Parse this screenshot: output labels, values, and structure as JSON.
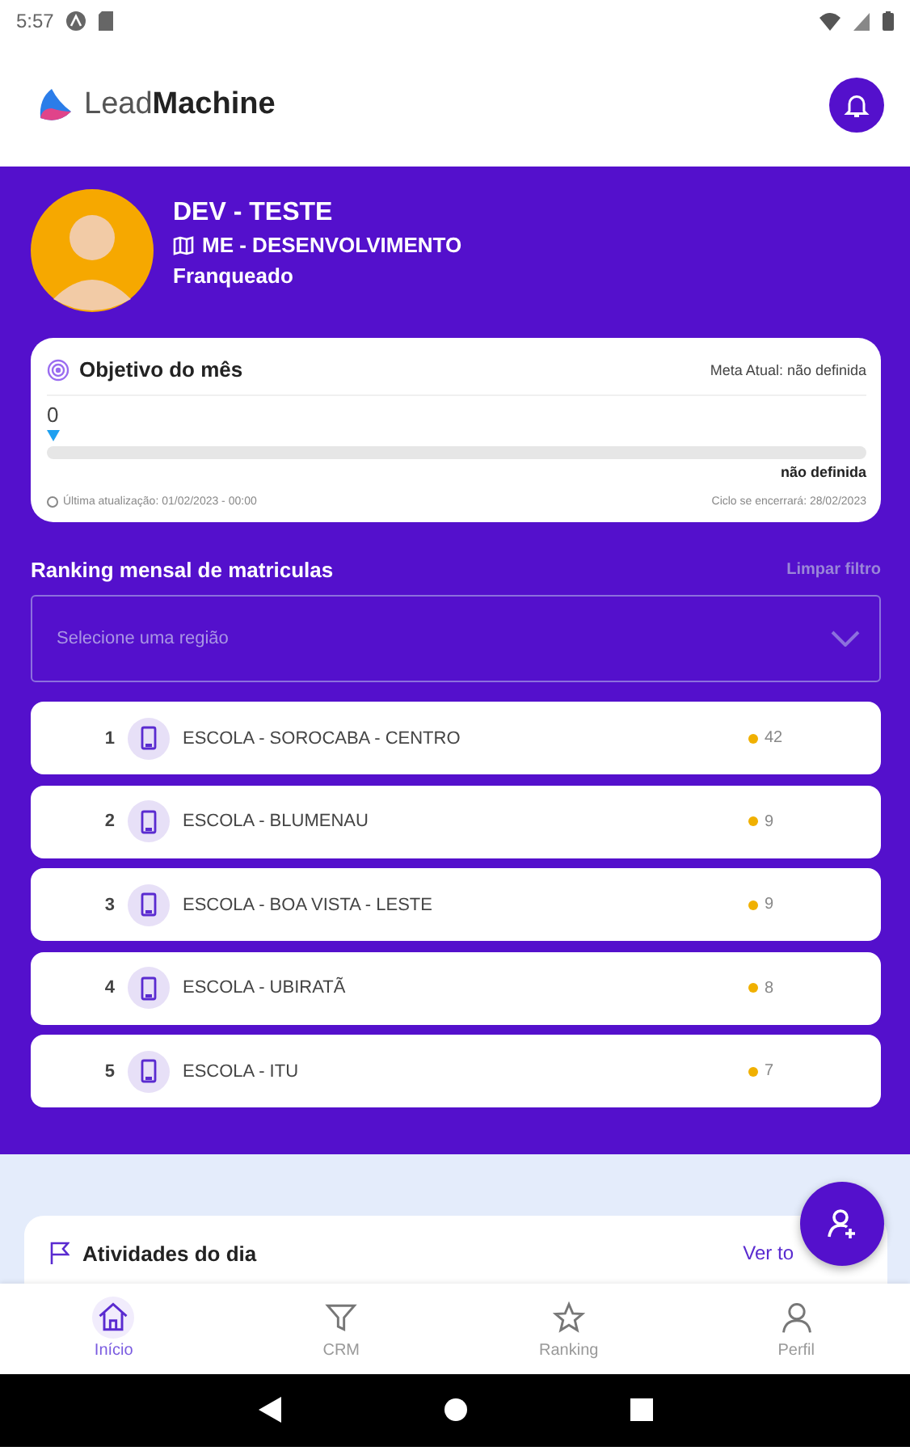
{
  "status_bar": {
    "time": "5:57"
  },
  "header": {
    "brand_light": "Lead",
    "brand_bold": "Machine"
  },
  "profile": {
    "name": "DEV - TESTE",
    "unit": "ME - DESENVOLVIMENTO",
    "role": "Franqueado"
  },
  "goal": {
    "title": "Objetivo do mês",
    "current_goal": "Meta Atual: não definida",
    "value": "0",
    "level": 0,
    "target": "não definida",
    "updated": "Última atualização: 01/02/2023 - 00:00",
    "cycle_end": "Ciclo se encerrará: 28/02/2023"
  },
  "ranking": {
    "title": "Ranking mensal de matriculas",
    "clear_filter": "Limpar filtro",
    "region_select": {
      "placeholder": "Selecione uma região"
    },
    "rows": [
      {
        "rank": "1",
        "name": "ESCOLA - SOROCABA - CENTRO",
        "count": "42"
      },
      {
        "rank": "2",
        "name": "ESCOLA - BLUMENAU",
        "count": "9"
      },
      {
        "rank": "3",
        "name": "ESCOLA - BOA VISTA - LESTE",
        "count": "9"
      },
      {
        "rank": "4",
        "name": "ESCOLA - UBIRATÃ",
        "count": "8"
      },
      {
        "rank": "5",
        "name": "ESCOLA - ITU",
        "count": "7"
      }
    ]
  },
  "activities": {
    "title": "Atividades do dia",
    "see_all": "Ver to"
  },
  "bottom_nav": [
    {
      "label": "Início",
      "selected": true
    },
    {
      "label": "CRM",
      "selected": false
    },
    {
      "label": "Ranking",
      "selected": false
    },
    {
      "label": "Perfil",
      "selected": false
    }
  ]
}
